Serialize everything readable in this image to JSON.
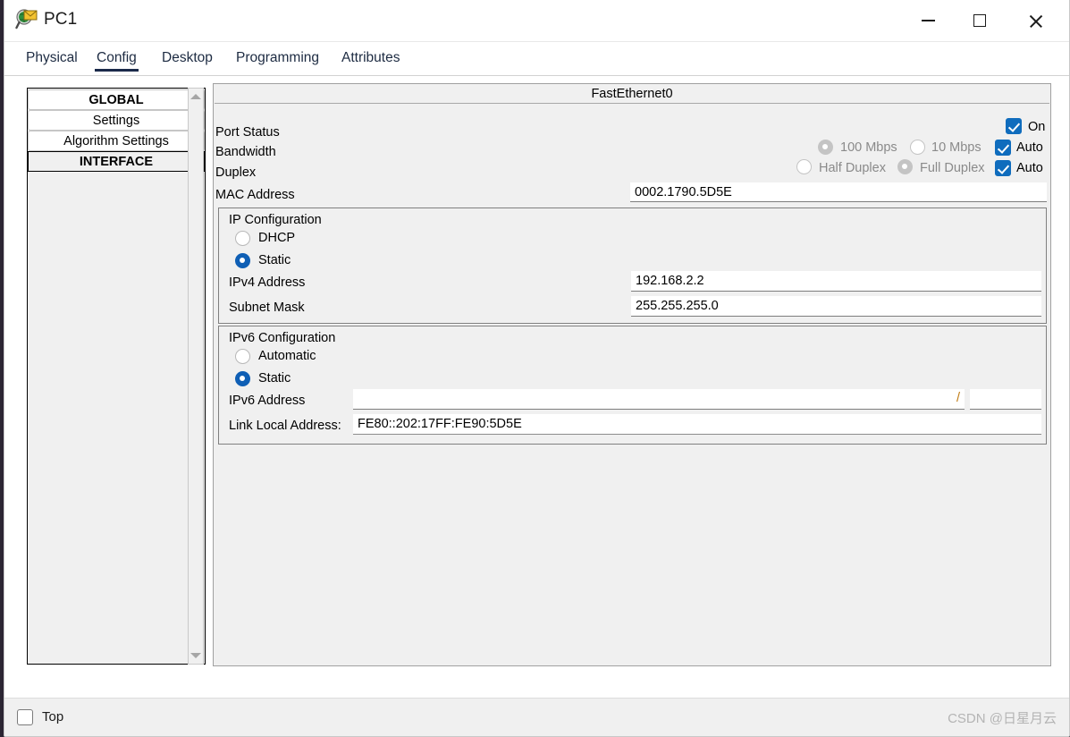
{
  "window": {
    "title": "PC1",
    "icon": "packet-tracer-icon",
    "controls": {
      "minimize": "minimize-icon",
      "maximize": "maximize-icon",
      "close": "close-icon"
    }
  },
  "tabs": [
    {
      "label": "Physical",
      "active": false
    },
    {
      "label": "Config",
      "active": true
    },
    {
      "label": "Desktop",
      "active": false
    },
    {
      "label": "Programming",
      "active": false
    },
    {
      "label": "Attributes",
      "active": false
    }
  ],
  "sidebar": {
    "items": [
      {
        "label": "GLOBAL",
        "type": "header"
      },
      {
        "label": "Settings",
        "type": "item"
      },
      {
        "label": "Algorithm Settings",
        "type": "item"
      },
      {
        "label": "INTERFACE",
        "type": "header"
      }
    ],
    "scrollbar": {
      "up": "scroll-up-arrow-icon",
      "down": "scroll-down-arrow-icon"
    }
  },
  "panel": {
    "title": "FastEthernet0",
    "port_status": {
      "label": "Port Status",
      "checkbox_label": "On",
      "checked": true
    },
    "bandwidth": {
      "label": "Bandwidth",
      "options": [
        {
          "label": "100 Mbps",
          "selected": true,
          "disabled": true
        },
        {
          "label": "10 Mbps",
          "selected": false,
          "disabled": true
        }
      ],
      "auto_label": "Auto",
      "auto_checked": true
    },
    "duplex": {
      "label": "Duplex",
      "options": [
        {
          "label": "Half Duplex",
          "selected": false,
          "disabled": true
        },
        {
          "label": "Full Duplex",
          "selected": true,
          "disabled": true
        }
      ],
      "auto_label": "Auto",
      "auto_checked": true
    },
    "mac": {
      "label": "MAC Address",
      "value": "0002.1790.5D5E"
    },
    "ip_config": {
      "title": "IP Configuration",
      "modes": [
        {
          "label": "DHCP",
          "selected": false
        },
        {
          "label": "Static",
          "selected": true
        }
      ],
      "ipv4": {
        "label": "IPv4 Address",
        "value": "192.168.2.2",
        "placeholder": ""
      },
      "subnet": {
        "label": "Subnet Mask",
        "value": "255.255.255.0",
        "placeholder": ""
      }
    },
    "ipv6_config": {
      "title": "IPv6 Configuration",
      "modes": [
        {
          "label": "Automatic",
          "selected": false
        },
        {
          "label": "Static",
          "selected": true
        }
      ],
      "ipv6": {
        "label": "IPv6 Address",
        "value": "",
        "placeholder": "",
        "separator": "/",
        "prefix": ""
      },
      "link_local": {
        "label": "Link Local Address:",
        "value": "FE80::202:17FF:FE90:5D5E"
      }
    }
  },
  "footer": {
    "top_label": "Top",
    "top_checked": false,
    "watermark": "CSDN @日星月云"
  }
}
